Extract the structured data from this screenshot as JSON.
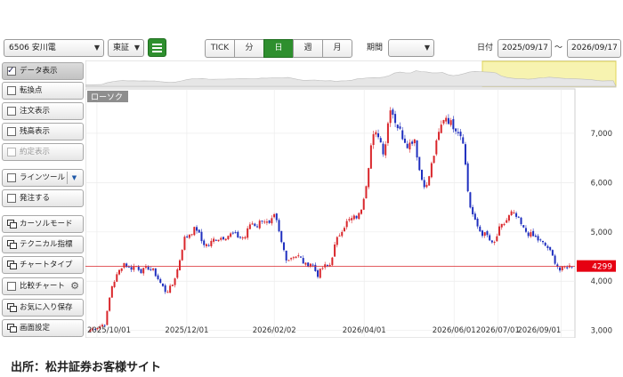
{
  "toolbar": {
    "symbol": "6506 安川電",
    "market": "東証",
    "intervals": [
      "TICK",
      "分",
      "日",
      "週",
      "月"
    ],
    "active_interval": "日",
    "period_label": "期間",
    "period_value": "",
    "date_label": "日付",
    "date_from": "2025/09/17",
    "date_sep": "～",
    "date_to": "2026/09/17"
  },
  "sidebar": {
    "items": [
      {
        "label": "データ表示",
        "kind": "check",
        "checked": true
      },
      {
        "label": "転換点",
        "kind": "check",
        "checked": false
      },
      {
        "label": "注文表示",
        "kind": "check",
        "checked": false
      },
      {
        "label": "残高表示",
        "kind": "check",
        "checked": false
      },
      {
        "label": "約定表示",
        "kind": "check",
        "checked": false,
        "disabled": true
      },
      {
        "label": "ラインツール",
        "kind": "check",
        "checked": false,
        "dropdown": true
      },
      {
        "label": "発注する",
        "kind": "check",
        "checked": false
      },
      {
        "label": "カーソルモード",
        "kind": "window"
      },
      {
        "label": "テクニカル指標",
        "kind": "window"
      },
      {
        "label": "チャートタイプ",
        "kind": "window"
      },
      {
        "label": "比較チャート",
        "kind": "check",
        "checked": false,
        "gear": true
      },
      {
        "label": "お気に入り保存",
        "kind": "window"
      },
      {
        "label": "画面設定",
        "kind": "window"
      }
    ]
  },
  "chart_data": {
    "type": "candlestick",
    "series_tag": "ローソク",
    "x_labels": [
      "2025/10/01",
      "2025/12/01",
      "2026/02/02",
      "2026/04/01",
      "2026/06/01",
      "2026/07/01",
      "2026/09/01"
    ],
    "y_ticks": [
      "3,000",
      "4,000",
      "5,000",
      "6,000",
      "7,000"
    ],
    "ylim": [
      2850,
      7900
    ],
    "last_price": 4299,
    "last_price_label": "4299",
    "up_color": "#d9262b",
    "down_color": "#1f2fbf",
    "last_line_color": "#d9262b",
    "navigator_highlight": "#f7f3b0",
    "path_points": [
      [
        0,
        3020
      ],
      [
        6,
        3080
      ],
      [
        10,
        3150
      ],
      [
        14,
        3880
      ],
      [
        18,
        4140
      ],
      [
        22,
        4380
      ],
      [
        26,
        4250
      ],
      [
        30,
        4320
      ],
      [
        34,
        4200
      ],
      [
        38,
        4280
      ],
      [
        42,
        4200
      ],
      [
        46,
        3980
      ],
      [
        50,
        3780
      ],
      [
        54,
        3900
      ],
      [
        58,
        4280
      ],
      [
        62,
        4860
      ],
      [
        66,
        4980
      ],
      [
        70,
        5080
      ],
      [
        74,
        4780
      ],
      [
        78,
        4720
      ],
      [
        82,
        4860
      ],
      [
        86,
        4880
      ],
      [
        90,
        4920
      ],
      [
        94,
        4960
      ],
      [
        98,
        4900
      ],
      [
        102,
        4880
      ],
      [
        106,
        5200
      ],
      [
        110,
        5120
      ],
      [
        114,
        5280
      ],
      [
        118,
        5120
      ],
      [
        122,
        5330
      ],
      [
        126,
        4800
      ],
      [
        130,
        4420
      ],
      [
        134,
        4520
      ],
      [
        138,
        4500
      ],
      [
        142,
        4320
      ],
      [
        146,
        4380
      ],
      [
        150,
        4120
      ],
      [
        154,
        4300
      ],
      [
        158,
        4310
      ],
      [
        162,
        4780
      ],
      [
        166,
        5050
      ],
      [
        170,
        5220
      ],
      [
        174,
        5280
      ],
      [
        178,
        5350
      ],
      [
        182,
        5950
      ],
      [
        186,
        6900
      ],
      [
        190,
        7000
      ],
      [
        194,
        6580
      ],
      [
        198,
        7560
      ],
      [
        202,
        7200
      ],
      [
        206,
        6950
      ],
      [
        210,
        6750
      ],
      [
        214,
        6920
      ],
      [
        218,
        6120
      ],
      [
        222,
        5900
      ],
      [
        226,
        6450
      ],
      [
        230,
        6980
      ],
      [
        234,
        7380
      ],
      [
        238,
        7200
      ],
      [
        242,
        7100
      ],
      [
        246,
        6900
      ],
      [
        250,
        5600
      ],
      [
        254,
        5200
      ],
      [
        258,
        4980
      ],
      [
        262,
        4920
      ],
      [
        266,
        4700
      ],
      [
        270,
        5050
      ],
      [
        274,
        5200
      ],
      [
        278,
        5380
      ],
      [
        282,
        5280
      ],
      [
        286,
        5050
      ],
      [
        290,
        4950
      ],
      [
        294,
        4880
      ],
      [
        298,
        4780
      ],
      [
        302,
        4680
      ],
      [
        306,
        4450
      ],
      [
        310,
        4220
      ],
      [
        314,
        4300
      ],
      [
        318,
        4299
      ]
    ]
  },
  "caption": "出所：松井証券お客様サイト"
}
